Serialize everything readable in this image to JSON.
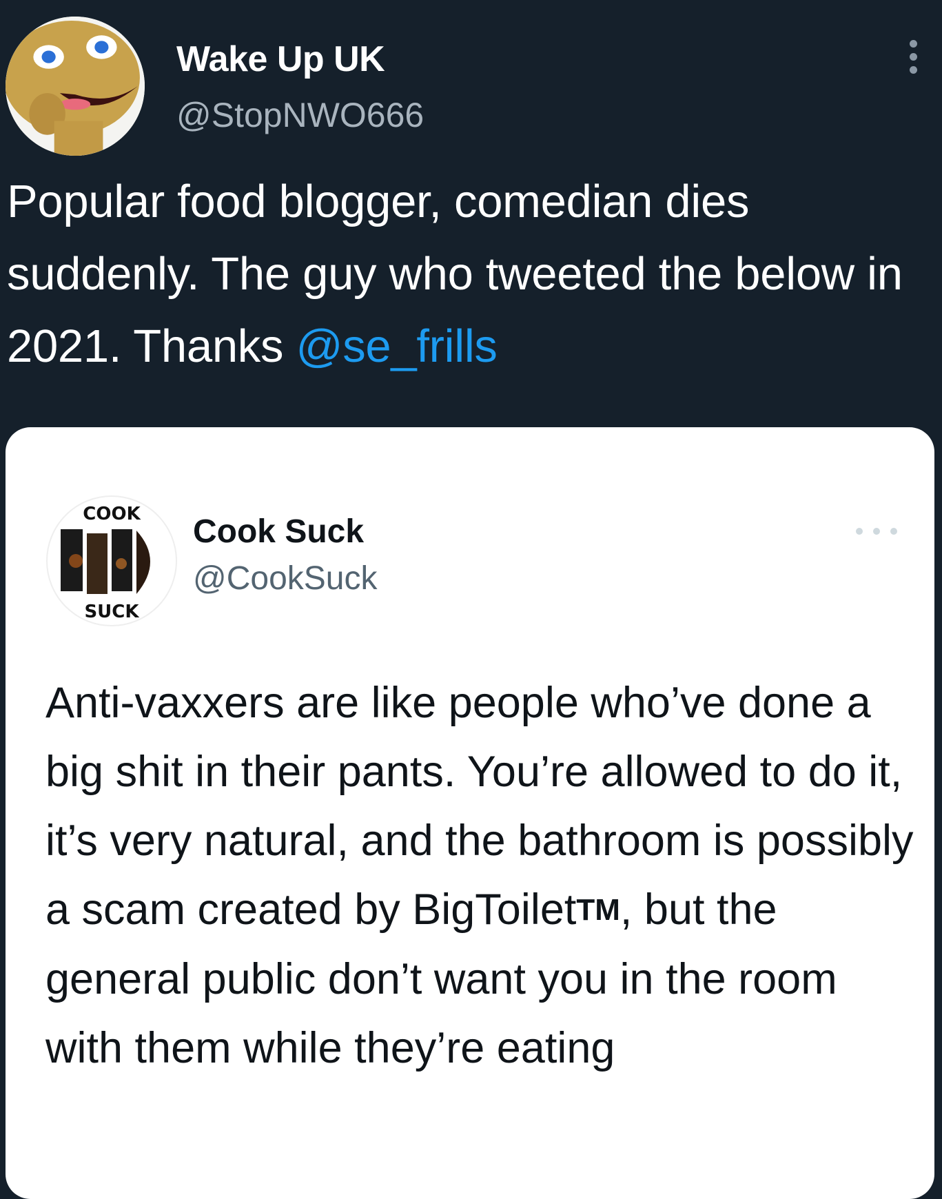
{
  "tweet": {
    "display_name": "Wake Up UK",
    "handle": "@StopNWO666",
    "text": "Popular food blogger, comedian dies suddenly. The guy who tweeted the below in 2021. Thanks ",
    "mention": "@se_frills",
    "more_icon": "more-vertical-icon"
  },
  "quoted": {
    "display_name": "Cook Suck",
    "handle": "@CookSuck",
    "avatar_text_top": "COOK",
    "avatar_text_bottom": "SUCK",
    "text_before_tm": "Anti-vaxxers are like people who’ve done a big shit in their pants. You’re allowed to do it, it’s very natural, and the bathroom is possibly a scam created by BigToilet",
    "tm": "TM",
    "text_after_tm": ", but the general public don’t want you in the room with them while they’re eating",
    "more_icon": "more-horizontal-icon"
  },
  "colors": {
    "background": "#15202b",
    "mention": "#1d9bf0",
    "card": "#ffffff"
  }
}
